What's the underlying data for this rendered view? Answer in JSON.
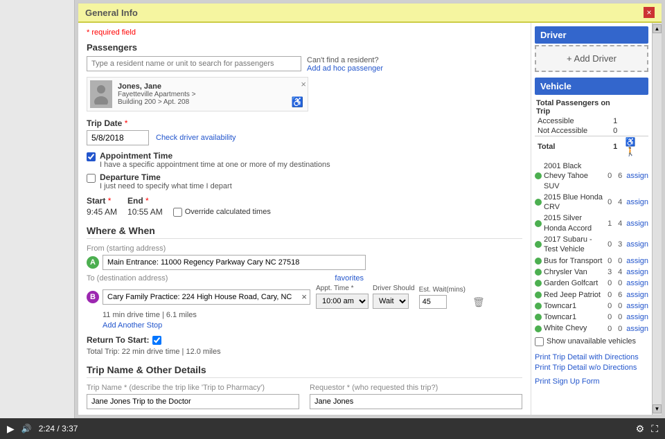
{
  "header": {
    "title": "General Info",
    "close_label": "×"
  },
  "required_note": "* required field",
  "passengers": {
    "section_label": "Passengers",
    "search_placeholder": "Type a resident name or unit to search for passengers",
    "cant_find": "Can't find a resident?",
    "add_adhoc": "Add ad hoc passenger",
    "passenger": {
      "name": "Jones, Jane",
      "detail1": "Fayetteville Apartments >",
      "detail2": "Building 200 > Apt. 208"
    }
  },
  "trip_date": {
    "label": "Trip Date",
    "value": "5/8/2018",
    "check_availability": "Check driver availability"
  },
  "appointment_time": {
    "label": "Appointment Time",
    "description": "I have a specific appointment time at one or more of my destinations",
    "checked": true
  },
  "departure_time": {
    "label": "Departure Time",
    "description": "I just need to specify what time I depart",
    "checked": false
  },
  "start_end": {
    "start_label": "Start",
    "end_label": "End",
    "start_val": "9:45 AM",
    "end_val": "10:55 AM",
    "override_label": "Override calculated times"
  },
  "where_when": {
    "title": "Where & When",
    "from_label": "From (starting address)",
    "from_value": "Main Entrance: 11000 Regency Parkway Cary NC 27518",
    "to_label": "To (destination address)",
    "favorites_label": "favorites",
    "to_value": "Cary Family Practice: 224 High House Road, Cary, NC",
    "appt_time_label": "Appt. Time *",
    "appt_time_value": "10:00 am",
    "driver_should_label": "Driver Should",
    "driver_should_value": "Wait",
    "est_wait_label": "Est. Wait(mins)",
    "est_wait_value": "45",
    "drive_info": "11 min drive time | 6.1 miles",
    "add_stop": "Add Another Stop",
    "return_label": "Return To Start:",
    "total_trip": "Total Trip: 22 min drive time | 12.0 miles"
  },
  "trip_name_details": {
    "title": "Trip Name & Other Details",
    "trip_name_label": "Trip Name * (describe the trip like 'Trip to Pharmacy')",
    "trip_name_placeholder": "describe the trip like 'Trip to Pharmacy'",
    "trip_name_value": "Jane Jones Trip to the Doctor",
    "requestor_label": "Requestor * (who requested this trip?)",
    "requestor_placeholder": "who requested this trip?",
    "requestor_value": "Jane Jones"
  },
  "driver_panel": {
    "header": "Driver",
    "add_driver_label": "+ Add Driver"
  },
  "vehicle_panel": {
    "header": "Vehicle",
    "passengers_title": "Total Passengers on Trip",
    "accessible_label": "Accessible",
    "accessible_count": "1",
    "not_accessible_label": "Not Accessible",
    "not_accessible_count": "0",
    "total_label": "Total",
    "total_count": "1",
    "vehicles": [
      {
        "name": "2001 Black Chevy Tahoe SUV",
        "n1": "0",
        "n2": "6",
        "assign": "assign",
        "active": true
      },
      {
        "name": "2015 Blue Honda CRV",
        "n1": "0",
        "n2": "4",
        "assign": "assign",
        "active": true
      },
      {
        "name": "2015 Silver Honda Accord",
        "n1": "1",
        "n2": "4",
        "assign": "assign",
        "active": true
      },
      {
        "name": "2017 Subaru - Test Vehicle",
        "n1": "0",
        "n2": "3",
        "assign": "assign",
        "active": true
      },
      {
        "name": "Bus for Transport",
        "n1": "0",
        "n2": "0",
        "assign": "assign",
        "active": true
      },
      {
        "name": "Chrysler Van",
        "n1": "3",
        "n2": "4",
        "assign": "assign",
        "active": true
      },
      {
        "name": "Garden Golfcart",
        "n1": "0",
        "n2": "0",
        "assign": "assign",
        "active": true
      },
      {
        "name": "Red Jeep Patriot",
        "n1": "0",
        "n2": "6",
        "assign": "assign",
        "active": true
      },
      {
        "name": "Towncar1",
        "n1": "0",
        "n2": "0",
        "assign": "assign",
        "active": true
      },
      {
        "name": "Towncar1",
        "n1": "0",
        "n2": "0",
        "assign": "assign",
        "active": true
      },
      {
        "name": "White Chevy",
        "n1": "0",
        "n2": "0",
        "assign": "assign",
        "active": true
      }
    ],
    "show_unavailable": "Show unavailable vehicles"
  },
  "print_links": {
    "link1": "Print Trip Detail with Directions",
    "link2": "Print Trip Detail w/o Directions",
    "link3": "Print Sign Up Form"
  },
  "bottom_bar": {
    "time_current": "2:24",
    "time_total": "3:37"
  }
}
